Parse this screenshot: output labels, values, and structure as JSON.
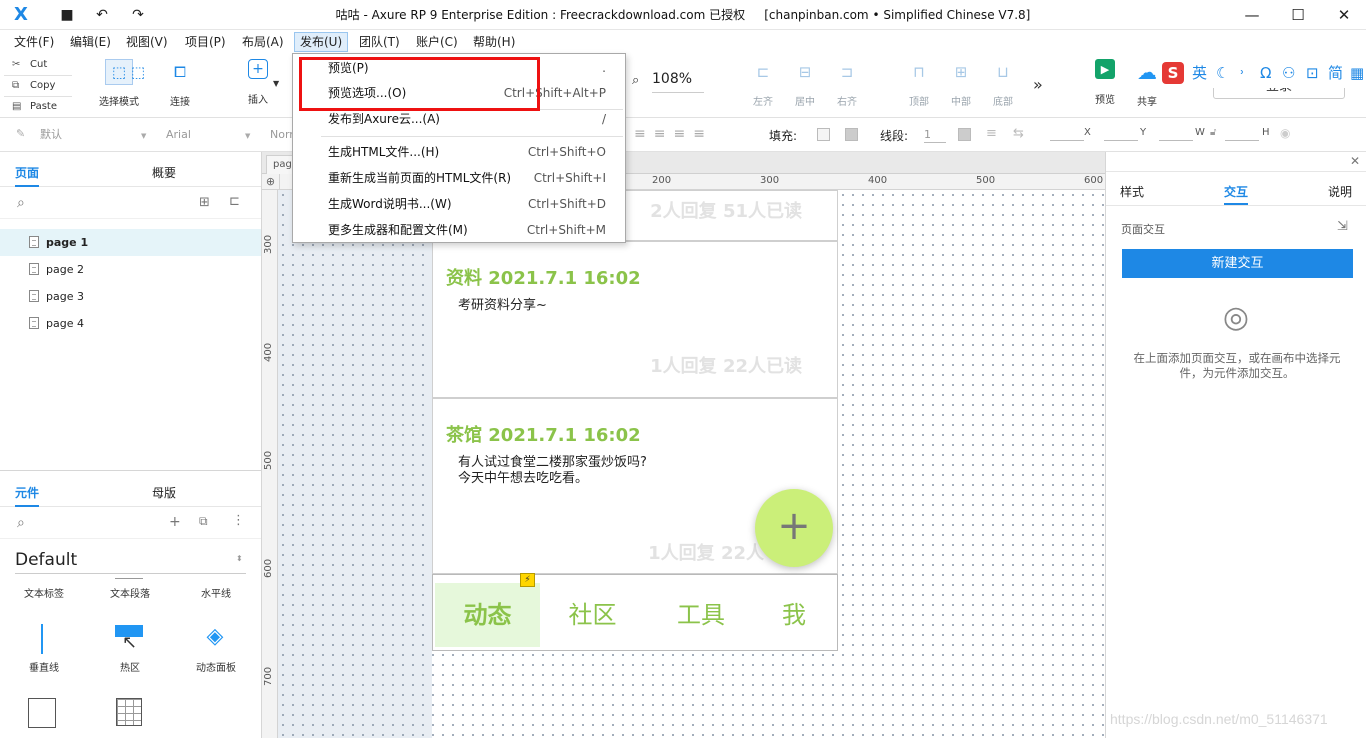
{
  "window": {
    "title": "咕咕 - Axure RP 9 Enterprise Edition : Freecrackdownload.com 已授权",
    "edition": "[chanpinban.com • Simplified Chinese V7.8]"
  },
  "menu": [
    "文件(F)",
    "编辑(E)",
    "视图(V)",
    "项目(P)",
    "布局(A)",
    "发布(U)",
    "团队(T)",
    "账户(C)",
    "帮助(H)"
  ],
  "clipboard": {
    "cut": "Cut",
    "copy": "Copy",
    "paste": "Paste"
  },
  "toolbar": {
    "select_mode": "选择模式",
    "connect": "连接",
    "insert": "插入",
    "zoom": "108%",
    "align_left": "左齐",
    "align_center": "居中",
    "align_right": "右齐",
    "align_top": "顶部",
    "align_middle": "中部",
    "align_bottom": "底部",
    "more": "»",
    "preview": "预览",
    "share": "共享",
    "login": "登录"
  },
  "stylebar": {
    "style_default": "默认",
    "font": "Arial",
    "normal": "Norr",
    "fill_label": "填充:",
    "line_label": "线段:",
    "line_width": "1",
    "x": "X",
    "y": "Y",
    "w": "W",
    "h": "H"
  },
  "pages_panel": {
    "tab_pages": "页面",
    "tab_outline": "概要",
    "pages": [
      "page 1",
      "page 2",
      "page 3",
      "page 4"
    ]
  },
  "library_panel": {
    "tab_widgets": "元件",
    "tab_masters": "母版",
    "library": "Default",
    "widgets": [
      "文本标签",
      "文本段落",
      "水平线",
      "垂直线",
      "热区",
      "动态面板"
    ]
  },
  "canvas": {
    "tab": "page",
    "ruler_h": [
      "200",
      "300",
      "400",
      "500",
      "600"
    ],
    "ruler_v": [
      "300",
      "400",
      "500",
      "600",
      "700"
    ]
  },
  "posts": [
    {
      "meta": "2人回复 51人已读"
    },
    {
      "title": "资料 2021.7.1 16:02",
      "body": [
        "考研资料分享~"
      ],
      "meta": "1人回复 22人已读"
    },
    {
      "title": "茶馆 2021.7.1 16:02",
      "body": [
        "有人试过食堂二楼那家蛋炒饭吗?",
        "今天中午想去吃吃看。"
      ],
      "meta": "1人回复 22人"
    }
  ],
  "fab_label": "+",
  "nav_tabs": [
    "动态",
    "社区",
    "工具",
    "我"
  ],
  "publish_menu": [
    {
      "label": "预览(P)",
      "shortcut": "."
    },
    {
      "label": "预览选项...(O)",
      "shortcut": "Ctrl+Shift+Alt+P"
    },
    {
      "label": "发布到Axure云...(A)",
      "shortcut": "/"
    },
    {
      "label": "生成HTML文件...(H)",
      "shortcut": "Ctrl+Shift+O"
    },
    {
      "label": "重新生成当前页面的HTML文件(R)",
      "shortcut": "Ctrl+Shift+I"
    },
    {
      "label": "生成Word说明书...(W)",
      "shortcut": "Ctrl+Shift+D"
    },
    {
      "label": "更多生成器和配置文件(M)",
      "shortcut": "Ctrl+Shift+M"
    }
  ],
  "right_panel": {
    "tab_style": "样式",
    "tab_interact": "交互",
    "tab_notes": "说明",
    "page_interaction": "页面交互",
    "new_interaction": "新建交互",
    "hint": [
      "在上面添加页面交互，或在画布中选择元",
      "件，为元件添加交互。"
    ]
  },
  "ime": {
    "lang": "英"
  },
  "watermark": "https://blog.csdn.net/m0_51146371",
  "colors": {
    "accent": "#1e88e5",
    "post_green": "#8bc34a",
    "fab": "#cbef79",
    "highlight": "#ee1111"
  }
}
